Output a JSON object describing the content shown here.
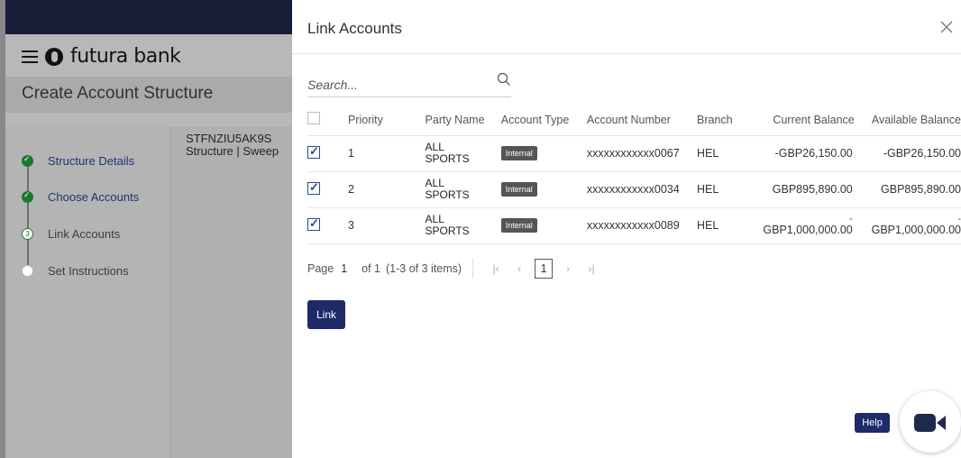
{
  "background": {
    "brand": "futura bank",
    "page_title": "Create Account Structure",
    "structure_code": "STFNZIU5AK9S",
    "structure_sub": "Structure  |  Sweep",
    "steps": [
      {
        "number": "",
        "label": "Structure Details",
        "state": "done"
      },
      {
        "number": "",
        "label": "Choose Accounts",
        "state": "done"
      },
      {
        "number": "3",
        "label": "Link Accounts",
        "state": "current"
      },
      {
        "number": "",
        "label": "Set Instructions",
        "state": "pending"
      }
    ]
  },
  "modal": {
    "title": "Link Accounts",
    "search_placeholder": "Search...",
    "columns": [
      "Priority",
      "Party Name",
      "Account Type",
      "Account Number",
      "Branch",
      "Current Balance",
      "Available Balance"
    ],
    "rows": [
      {
        "checked": true,
        "priority": "1",
        "party_l1": "ALL",
        "party_l2": "SPORTS",
        "type": "Internal",
        "number": "xxxxxxxxxxxx0067",
        "branch": "HEL",
        "current_dash": "",
        "current": "-GBP26,150.00",
        "available_dash": "",
        "available": "-GBP26,150.00"
      },
      {
        "checked": true,
        "priority": "2",
        "party_l1": "ALL",
        "party_l2": "SPORTS",
        "type": "Internal",
        "number": "xxxxxxxxxxxx0034",
        "branch": "HEL",
        "current_dash": "",
        "current": "GBP895,890.00",
        "available_dash": "",
        "available": "GBP895,890.00"
      },
      {
        "checked": true,
        "priority": "3",
        "party_l1": "ALL",
        "party_l2": "SPORTS",
        "type": "Internal",
        "number": "xxxxxxxxxxxx0089",
        "branch": "HEL",
        "current_dash": "-",
        "current": "GBP1,000,000.00",
        "available_dash": "-",
        "available": "GBP1,000,000.00"
      }
    ],
    "pager": {
      "page_label": "Page",
      "page_value": "1",
      "of_text": "of 1",
      "items_text": "(1-3 of 3 items)",
      "current_page": "1"
    },
    "link_button": "Link"
  },
  "help_label": "Help",
  "colors": {
    "accent": "#1f2a6b",
    "success": "#1a7a2a",
    "badge": "#555555"
  }
}
